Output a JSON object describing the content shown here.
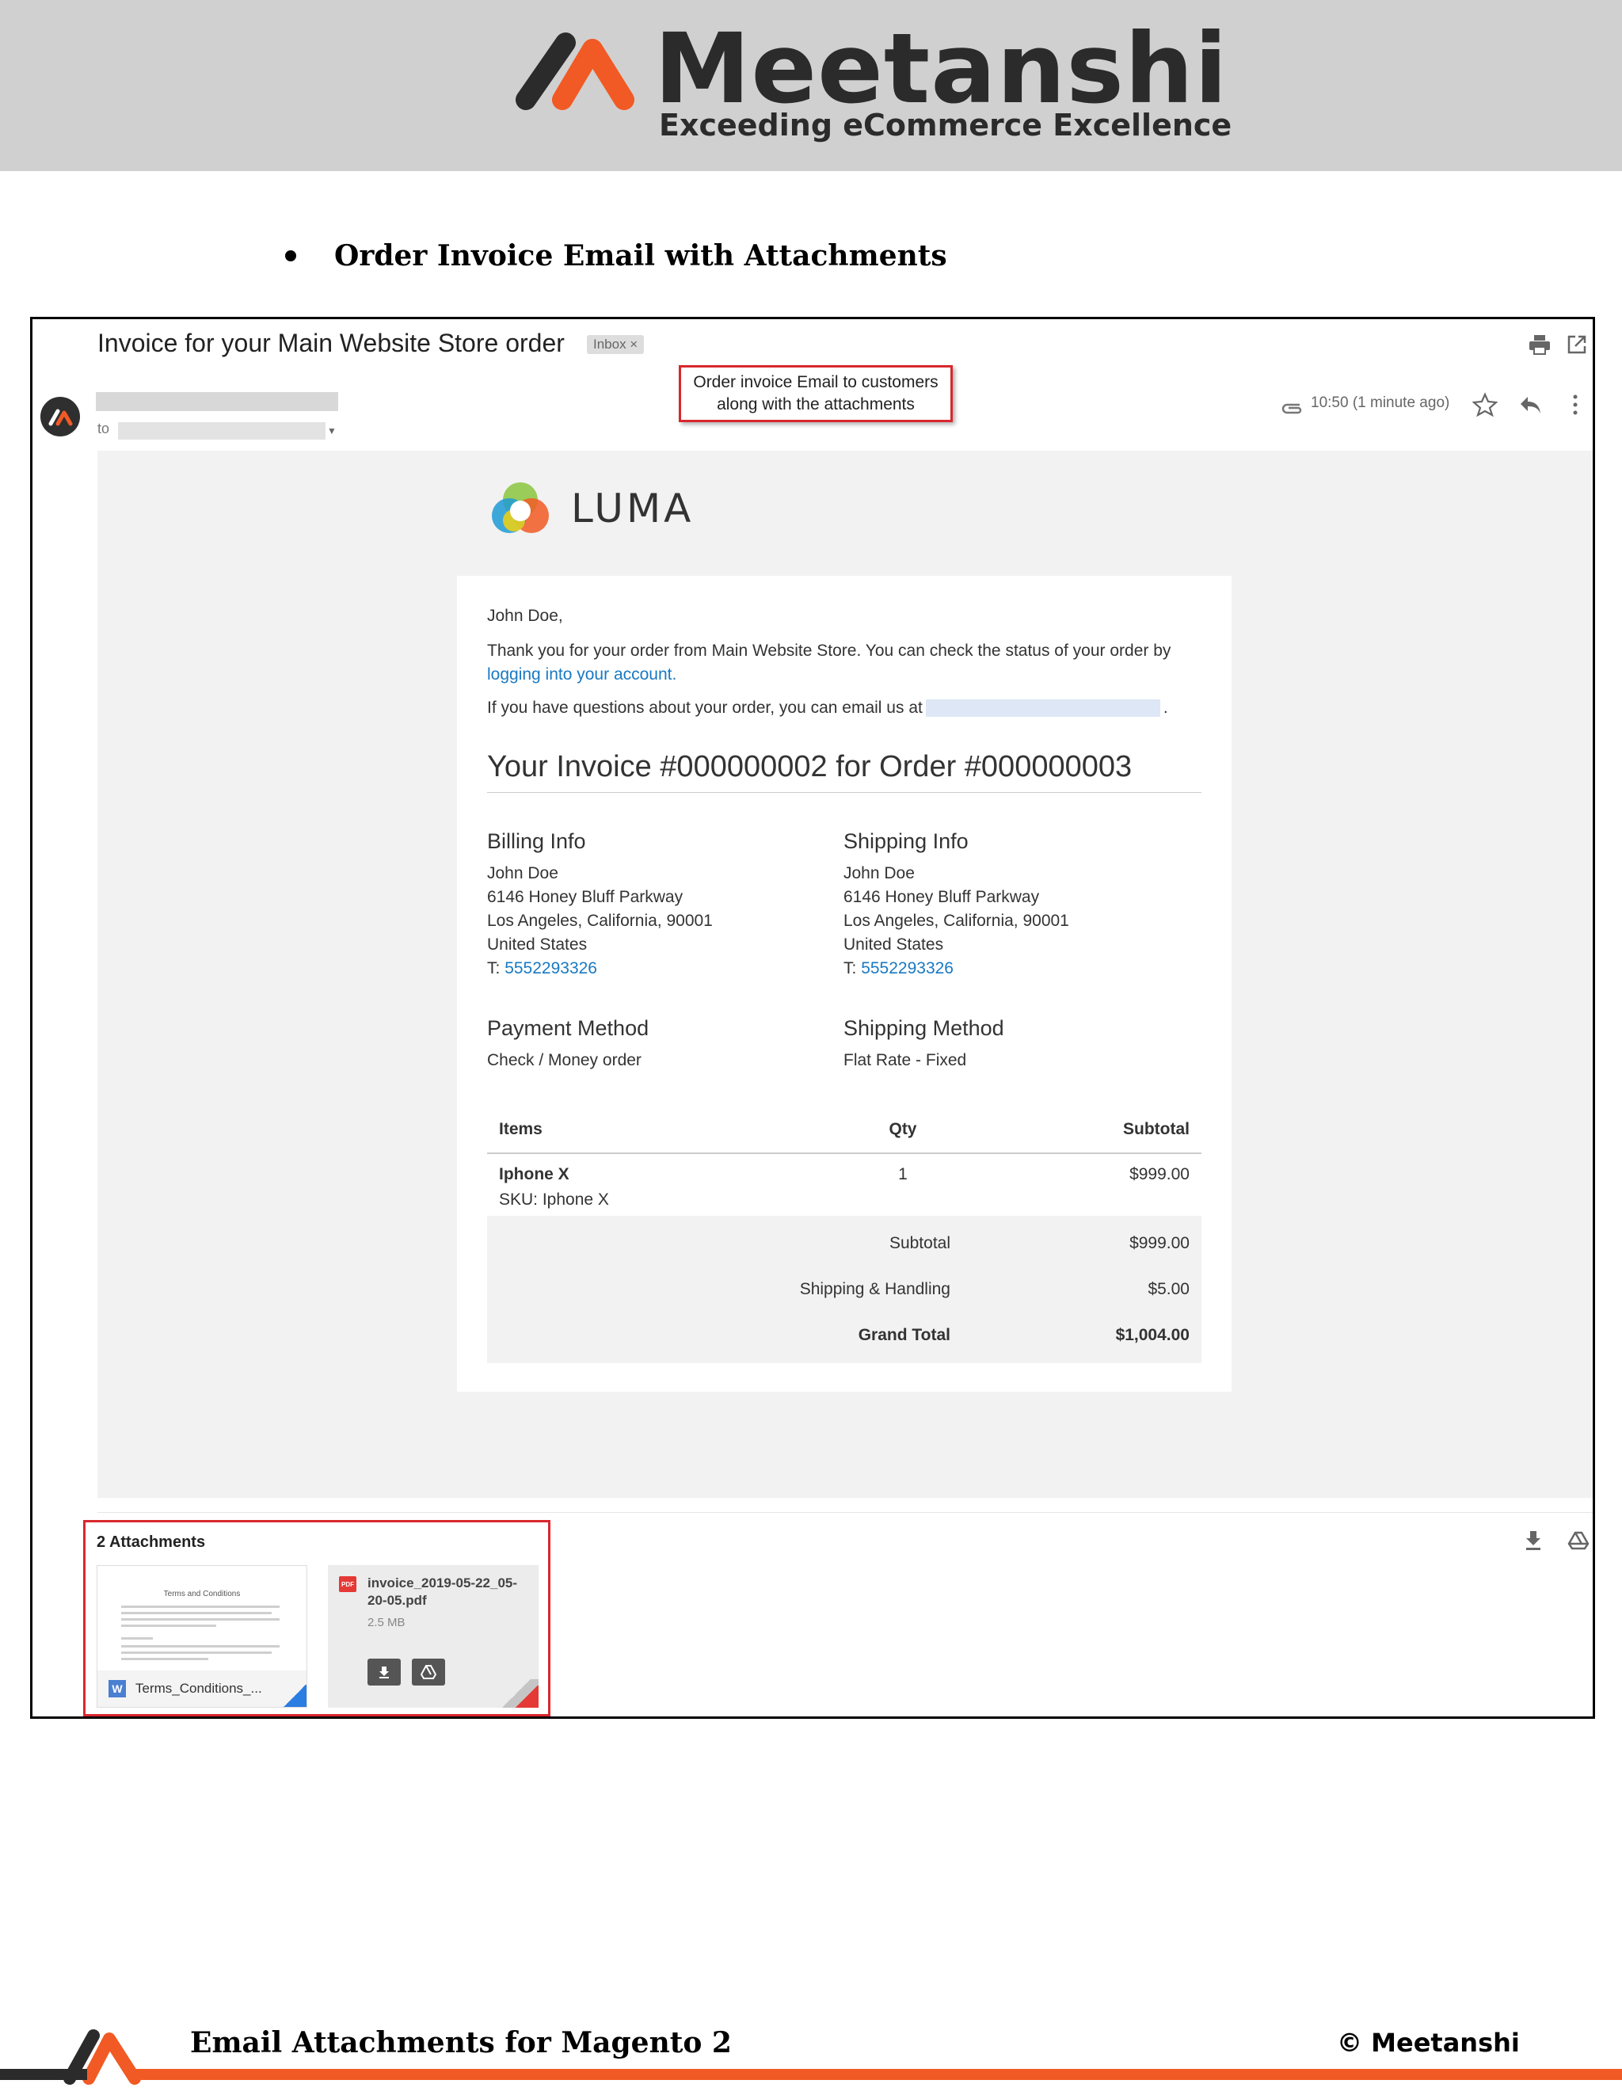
{
  "header": {
    "brand_name": "Meetanshi",
    "tagline": "Exceeding eCommerce Excellence",
    "colors": {
      "banner_bg": "#d1d0d1",
      "accent": "#f15a24",
      "dark": "#2b2b2b"
    }
  },
  "section": {
    "title": "Order Invoice Email with Attachments"
  },
  "email": {
    "subject": "Invoice for your Main Website Store order",
    "label_chip": "Inbox ×",
    "to_label": "to",
    "callout_line1": "Order invoice Email to customers",
    "callout_line2": "along with the attachments",
    "timestamp": "10:50 (1 minute ago)",
    "icons": [
      "print-icon",
      "popout-icon",
      "paperclip-icon",
      "star-icon",
      "reply-icon",
      "more-vert-icon"
    ]
  },
  "body": {
    "store_logo_text": "LUMA",
    "greeting": "John Doe,",
    "thanks": "Thank you for your order from Main Website Store. You can check the status of your order by",
    "account_link": "logging into your account.",
    "questions_pre": "If you have questions about your order, you can email us at",
    "questions_post": ".",
    "invoice_heading": "Your Invoice #000000002 for Order #000000003",
    "billing": {
      "heading": "Billing Info",
      "name": "John Doe",
      "street": "6146 Honey Bluff Parkway",
      "city": "Los Angeles, California, 90001",
      "country": "United States",
      "phone_prefix": "T:",
      "phone": "5552293326"
    },
    "shipping": {
      "heading": "Shipping Info",
      "name": "John Doe",
      "street": "6146 Honey Bluff Parkway",
      "city": "Los Angeles, California, 90001",
      "country": "United States",
      "phone_prefix": "T:",
      "phone": "5552293326"
    },
    "payment": {
      "heading": "Payment Method",
      "value": "Check / Money order"
    },
    "shipping_method": {
      "heading": "Shipping Method",
      "value": "Flat Rate - Fixed"
    },
    "table": {
      "headers": [
        "Items",
        "Qty",
        "Subtotal"
      ],
      "items": [
        {
          "name": "Iphone X",
          "sku": "SKU: Iphone X",
          "qty": "1",
          "subtotal": "$999.00"
        }
      ],
      "totals": [
        {
          "label": "Subtotal",
          "value": "$999.00"
        },
        {
          "label": "Shipping & Handling",
          "value": "$5.00"
        },
        {
          "label": "Grand Total",
          "value": "$1,004.00"
        }
      ]
    }
  },
  "attachments": {
    "count_label": "2 Attachments",
    "files": [
      {
        "name": "Terms_Conditions_...",
        "type_badge": "W",
        "preview_title": "Terms and Conditions"
      },
      {
        "name": "invoice_2019-05-22_05-20-05.pdf",
        "type_badge": "PDF",
        "size": "2.5 MB"
      }
    ]
  },
  "footer": {
    "title": "Email Attachments for Magento 2",
    "copyright": "© Meetanshi"
  }
}
